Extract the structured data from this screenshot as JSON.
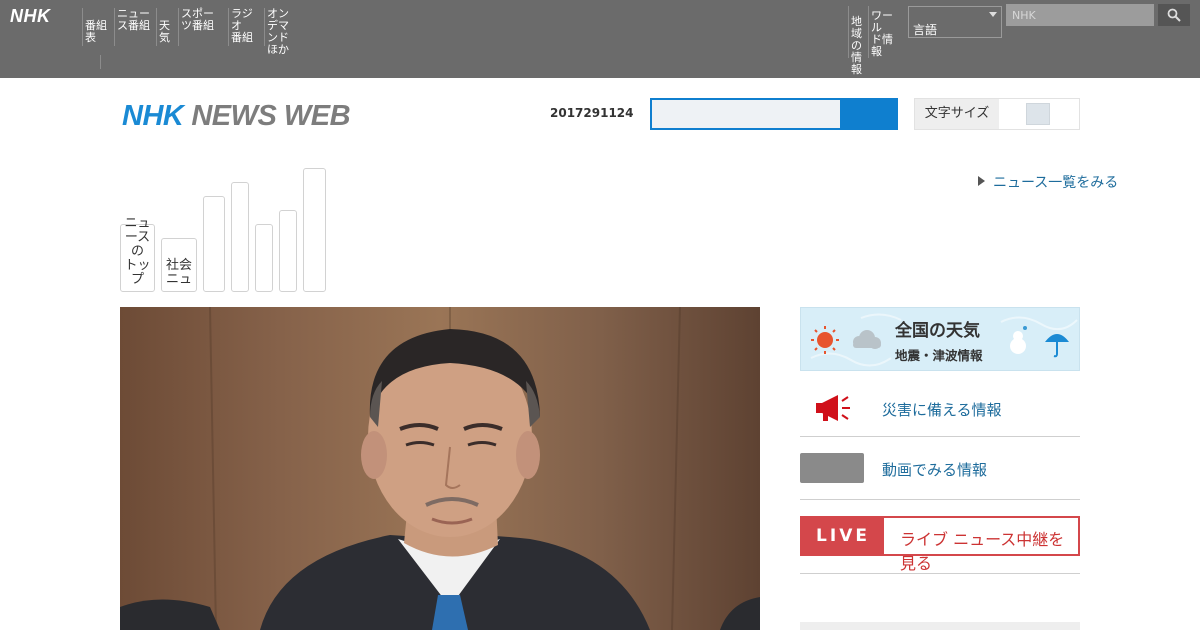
{
  "global_bar": {
    "logo": "NHK",
    "nav_items": [
      "番組\n表",
      "ニュー\nス番組",
      "天気",
      "スポー\nツ番組",
      "ラジオ\n番組",
      "オン\nデマンド\nほか"
    ],
    "right_items": [
      "地域\nの情\n報",
      "ワール\nド情報"
    ],
    "language_select": "言語",
    "search_placeholder": "NHK"
  },
  "header": {
    "brand_nhk": "NHK",
    "brand_news": "NEWS WEB",
    "date_stamp": "2017291124",
    "toggle_label": "文字サイズ"
  },
  "all_list_link": "ニュース一覧をみる",
  "genre_tabs": [
    {
      "label": "ニュ\nース\nの\nトップ"
    },
    {
      "label": "社会\nニュ"
    },
    {
      "label": ""
    },
    {
      "label": ""
    },
    {
      "label": ""
    },
    {
      "label": ""
    },
    {
      "label": ""
    }
  ],
  "weather_banner": {
    "title": "全国の天気",
    "subtitle": "地震・津波情報"
  },
  "side_links": {
    "alert_label": "災害に備える情報",
    "video_label": "動画でみる情報"
  },
  "live": {
    "badge": "LIVE",
    "text": "ライブ ニュース中継を見る"
  },
  "colors": {
    "topbar": "#6b6b6b",
    "brand_blue": "#1a8ad4",
    "link": "#1e6c9c",
    "live_red": "#d4474b"
  }
}
